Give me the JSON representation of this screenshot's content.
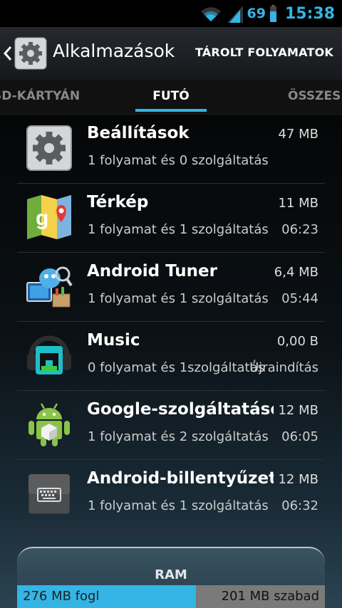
{
  "status_bar": {
    "battery_percent": "69",
    "time": "15:38",
    "icons": [
      "wifi-icon",
      "signal-icon",
      "battery-icon"
    ],
    "accent_color": "#33b5e5"
  },
  "action_bar": {
    "title": "Alkalmazások",
    "action_label": "TÁROLT FOLYAMATOK",
    "icons": [
      "back-chevron-icon",
      "settings-gear-icon"
    ]
  },
  "tabs": {
    "left": "SD-KÁRTYÁN",
    "selected": "FUTÓ",
    "right": "ÖSSZES"
  },
  "apps": [
    {
      "name": "Beállítások",
      "size": "47 MB",
      "desc": "1 folyamat és 0 szolgáltatás",
      "time": "",
      "icon": "settings-gear-icon"
    },
    {
      "name": "Térkép",
      "size": "11 MB",
      "desc": "1 folyamat és 1 szolgáltatás",
      "time": "06:23",
      "icon": "maps-icon"
    },
    {
      "name": "Android Tuner",
      "size": "6,4 MB",
      "desc": "1 folyamat és 1 szolgáltatás",
      "time": "05:44",
      "icon": "android-tuner-icon"
    },
    {
      "name": "Music",
      "size": "0,00 B",
      "desc": "0 folyamat és 1szolgáltatás",
      "time": "Újraindítás",
      "icon": "music-headphones-icon"
    },
    {
      "name": "Google-szolgáltatások",
      "size": "12 MB",
      "desc": "1 folyamat és 2 szolgáltatás",
      "time": "06:05",
      "icon": "android-robot-icon"
    },
    {
      "name": "Android-billentyűzet (AOSP)",
      "size": "12 MB",
      "desc": "1 folyamat és 1 szolgáltatás",
      "time": "06:32",
      "icon": "keyboard-icon"
    }
  ],
  "ram": {
    "label": "RAM",
    "used_text": "276 MB fogl",
    "free_text": "201 MB szabad",
    "used_fraction": 0.58
  }
}
